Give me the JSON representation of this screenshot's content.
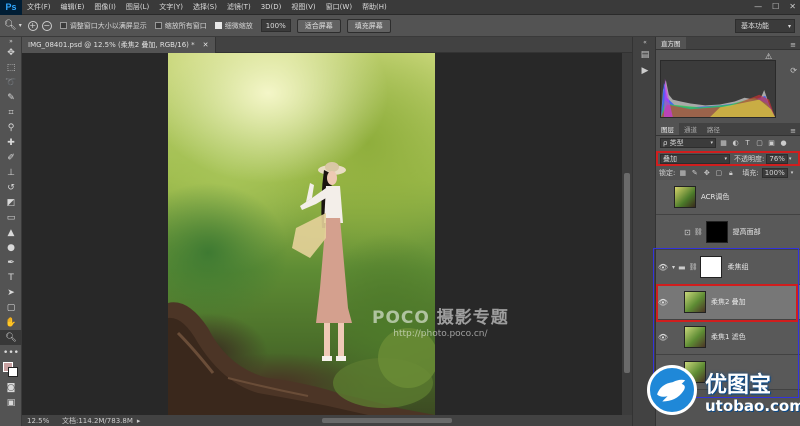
{
  "app": {
    "logo": "Ps"
  },
  "menu": [
    "文件(F)",
    "编辑(E)",
    "图像(I)",
    "图层(L)",
    "文字(Y)",
    "选择(S)",
    "滤镜(T)",
    "3D(D)",
    "视图(V)",
    "窗口(W)",
    "帮助(H)"
  ],
  "options": {
    "resize_window": "调整窗口大小以满屏显示",
    "zoom_all": "缩放所有窗口",
    "scrubby_zoom": "细微缩放",
    "zoom_value": "100%",
    "fit_screen": "适合屏幕",
    "fill_screen": "填充屏幕",
    "workspace": "基本功能"
  },
  "document": {
    "tab_title": "IMG_08401.psd @ 12.5% (柔焦2 叠加, RGB/16) *"
  },
  "status": {
    "zoom": "12.5%",
    "doc_size": "文档:114.2M/783.8M"
  },
  "watermark": {
    "brand": "POCO 摄影专题",
    "url": "http://photo.poco.cn/"
  },
  "panels": {
    "histogram_tab": "直方图",
    "layer_tabs": [
      "图层",
      "通道",
      "路径"
    ],
    "kind_filter": "ρ 类型",
    "blend_mode": "叠加",
    "opacity_label": "不透明度:",
    "opacity_value": "76%",
    "lock_label": "锁定:",
    "fill_label": "填充:",
    "fill_value": "100%"
  },
  "layers": [
    {
      "name": "ACR调色",
      "visible": false
    },
    {
      "name": "提高面部",
      "visible": false
    },
    {
      "name": "柔焦组",
      "visible": true
    },
    {
      "name": "柔焦2 叠加",
      "visible": true
    },
    {
      "name": "柔焦1 滤色",
      "visible": true
    },
    {
      "name": "",
      "visible": true
    }
  ],
  "logo": {
    "text": "优图宝",
    "url": "utobao.com"
  },
  "colors": {
    "accent": "#d01e1e",
    "group_outline": "#3333dd",
    "logo_blue": "#1f88d8"
  }
}
